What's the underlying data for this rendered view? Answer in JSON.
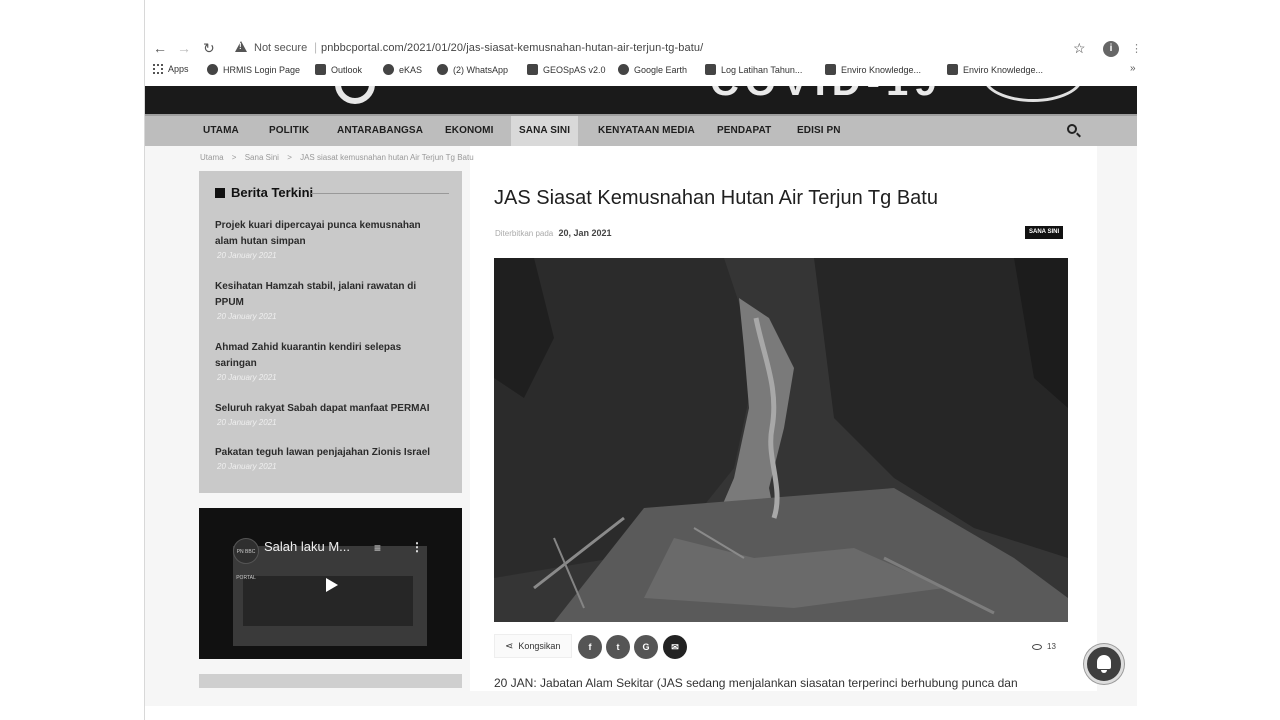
{
  "browser": {
    "not_secure": "Not secure",
    "url": "pnbbcportal.com/2021/01/20/jas-siasat-kemusnahan-hutan-air-terjun-tg-batu/",
    "profile_initial": "i",
    "bookmarks": [
      "Apps",
      "HRMIS Login Page",
      "Outlook",
      "eKAS",
      "(2) WhatsApp",
      "GEOSpAS v2.0",
      "Google Earth",
      "Log Latihan Tahun...",
      "Enviro Knowledge...",
      "Enviro Knowledge..."
    ]
  },
  "nav": {
    "items": [
      "UTAMA",
      "POLITIK",
      "ANTARABANGSA",
      "EKONOMI",
      "SANA SINI",
      "KENYATAAN MEDIA",
      "PENDAPAT",
      "EDISI PN"
    ],
    "active": "SANA SINI"
  },
  "breadcrumb": [
    "Utama",
    ">",
    "Sana Sini",
    ">",
    "JAS siasat kemusnahan hutan Air Terjun Tg Batu"
  ],
  "sidebar": {
    "widget_title": "Berita Terkini",
    "news": [
      {
        "title": "Projek kuari dipercayai punca kemusnahan alam hutan simpan",
        "date": "20 January 2021"
      },
      {
        "title": "Kesihatan Hamzah stabil, jalani rawatan di PPUM",
        "date": "20 January 2021"
      },
      {
        "title": "Ahmad Zahid kuarantin kendiri selepas saringan",
        "date": "20 January 2021"
      },
      {
        "title": "Seluruh rakyat Sabah dapat manfaat PERMAI",
        "date": "20 January 2021"
      },
      {
        "title": "Pakatan teguh lawan penjajahan Zionis Israel",
        "date": "20 January 2021"
      }
    ],
    "video": {
      "title": "Salah laku M...",
      "logo_text": "PN BBC PORTAL"
    }
  },
  "article": {
    "title": "JAS Siasat Kemusnahan Hutan Air Terjun Tg Batu",
    "meta_prefix": "Diterbitkan pada",
    "date": "20, Jan 2021",
    "category_badge": "SANA SINI",
    "share_label": "Kongsikan",
    "share_buttons": [
      "f",
      "t",
      "G",
      "✉"
    ],
    "views": "13",
    "body_first_line": "20 JAN: Jabatan Alam Sekitar (JAS sedang menjalankan siasatan terperinci berhubung punca dan"
  },
  "colors": {
    "header_bg": "#1a1a1a",
    "navbar_bg": "#bdbdbd",
    "widget_bg": "#c9c9c9",
    "badge_bg": "#111111"
  },
  "icons": [
    "back-icon",
    "forward-icon",
    "reload-icon",
    "warning-icon",
    "star-icon",
    "profile-icon",
    "search-icon",
    "share-icon",
    "facebook-icon",
    "twitter-icon",
    "google-icon",
    "email-icon",
    "eye-icon",
    "bell-icon",
    "play-icon"
  ]
}
